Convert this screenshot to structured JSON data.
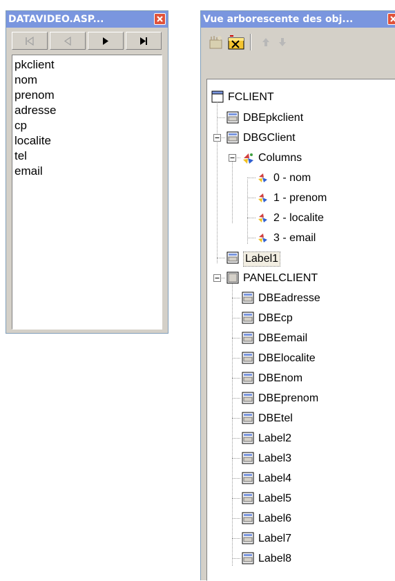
{
  "left_window": {
    "title": "DATAVIDEO.ASP...",
    "nav_buttons": [
      "first",
      "previous",
      "next",
      "last"
    ],
    "fields": [
      "pkclient",
      "nom",
      "prenom",
      "adresse",
      "cp",
      "localite",
      "tel",
      "email"
    ]
  },
  "right_window": {
    "title": "Vue arborescente des obj...",
    "toolbar_icons": [
      "new-object-icon",
      "delete-object-icon",
      "move-up-icon",
      "move-down-icon"
    ],
    "tree": {
      "root": "FCLIENT",
      "nodes": [
        {
          "label": "DBEpkclient",
          "icon": "control-icon"
        },
        {
          "label": "DBGClient",
          "icon": "control-icon",
          "expanded": true
        },
        {
          "label": "Columns",
          "icon": "columns-icon",
          "expanded": true
        },
        {
          "label": "0 - nom",
          "icon": "column-icon"
        },
        {
          "label": "1 - prenom",
          "icon": "column-icon"
        },
        {
          "label": "2 - localite",
          "icon": "column-icon"
        },
        {
          "label": "3 - email",
          "icon": "column-icon"
        },
        {
          "label": "Label1",
          "icon": "control-icon",
          "selected": true
        },
        {
          "label": "PANELCLIENT",
          "icon": "panel-icon",
          "expanded": true
        },
        {
          "label": "DBEadresse",
          "icon": "control-icon"
        },
        {
          "label": "DBEcp",
          "icon": "control-icon"
        },
        {
          "label": "DBEemail",
          "icon": "control-icon"
        },
        {
          "label": "DBElocalite",
          "icon": "control-icon"
        },
        {
          "label": "DBEnom",
          "icon": "control-icon"
        },
        {
          "label": "DBEprenom",
          "icon": "control-icon"
        },
        {
          "label": "DBEtel",
          "icon": "control-icon"
        },
        {
          "label": "Label2",
          "icon": "control-icon"
        },
        {
          "label": "Label3",
          "icon": "control-icon"
        },
        {
          "label": "Label4",
          "icon": "control-icon"
        },
        {
          "label": "Label5",
          "icon": "control-icon"
        },
        {
          "label": "Label6",
          "icon": "control-icon"
        },
        {
          "label": "Label7",
          "icon": "control-icon"
        },
        {
          "label": "Label8",
          "icon": "control-icon"
        }
      ]
    }
  },
  "colors": {
    "titlebar": "#7a96df",
    "window_face": "#d4d0c8",
    "close_button": "#e0523a"
  }
}
